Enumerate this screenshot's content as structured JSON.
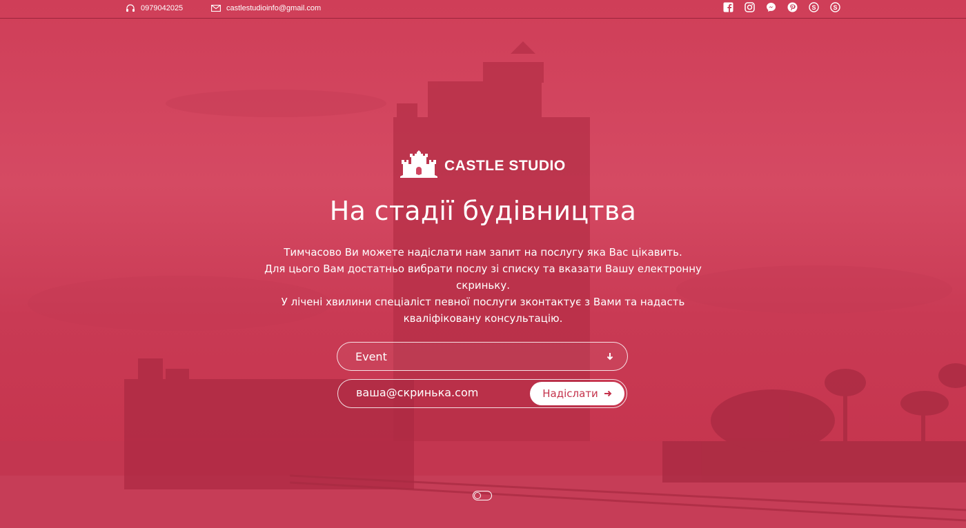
{
  "topbar": {
    "phone": "0979042025",
    "email": "castlestudioinfo@gmail.com",
    "social": [
      "facebook-icon",
      "instagram-icon",
      "messenger-icon",
      "pinterest-icon",
      "skype-icon",
      "skype-icon"
    ]
  },
  "brand": {
    "name": "CASTLE STUDIO"
  },
  "hero": {
    "title": "На стадії будівництва",
    "line1": "Тимчасово Ви можете надіслати нам запит на послугу яка Вас цікавить.",
    "line2": "Для цього Вам достатньо вибрати послу зі списку та вказати Вашу електронну скриньку.",
    "line3": "У лічені хвилини спеціаліст певної послуги зконтактує з Вами та надасть кваліфіковану консультацію."
  },
  "form": {
    "service_value": "Event",
    "email_placeholder": "ваша@скринька.com",
    "submit_label": "Надіслати"
  },
  "colors": {
    "overlay": "#d04560",
    "button_text": "#c4324b"
  }
}
